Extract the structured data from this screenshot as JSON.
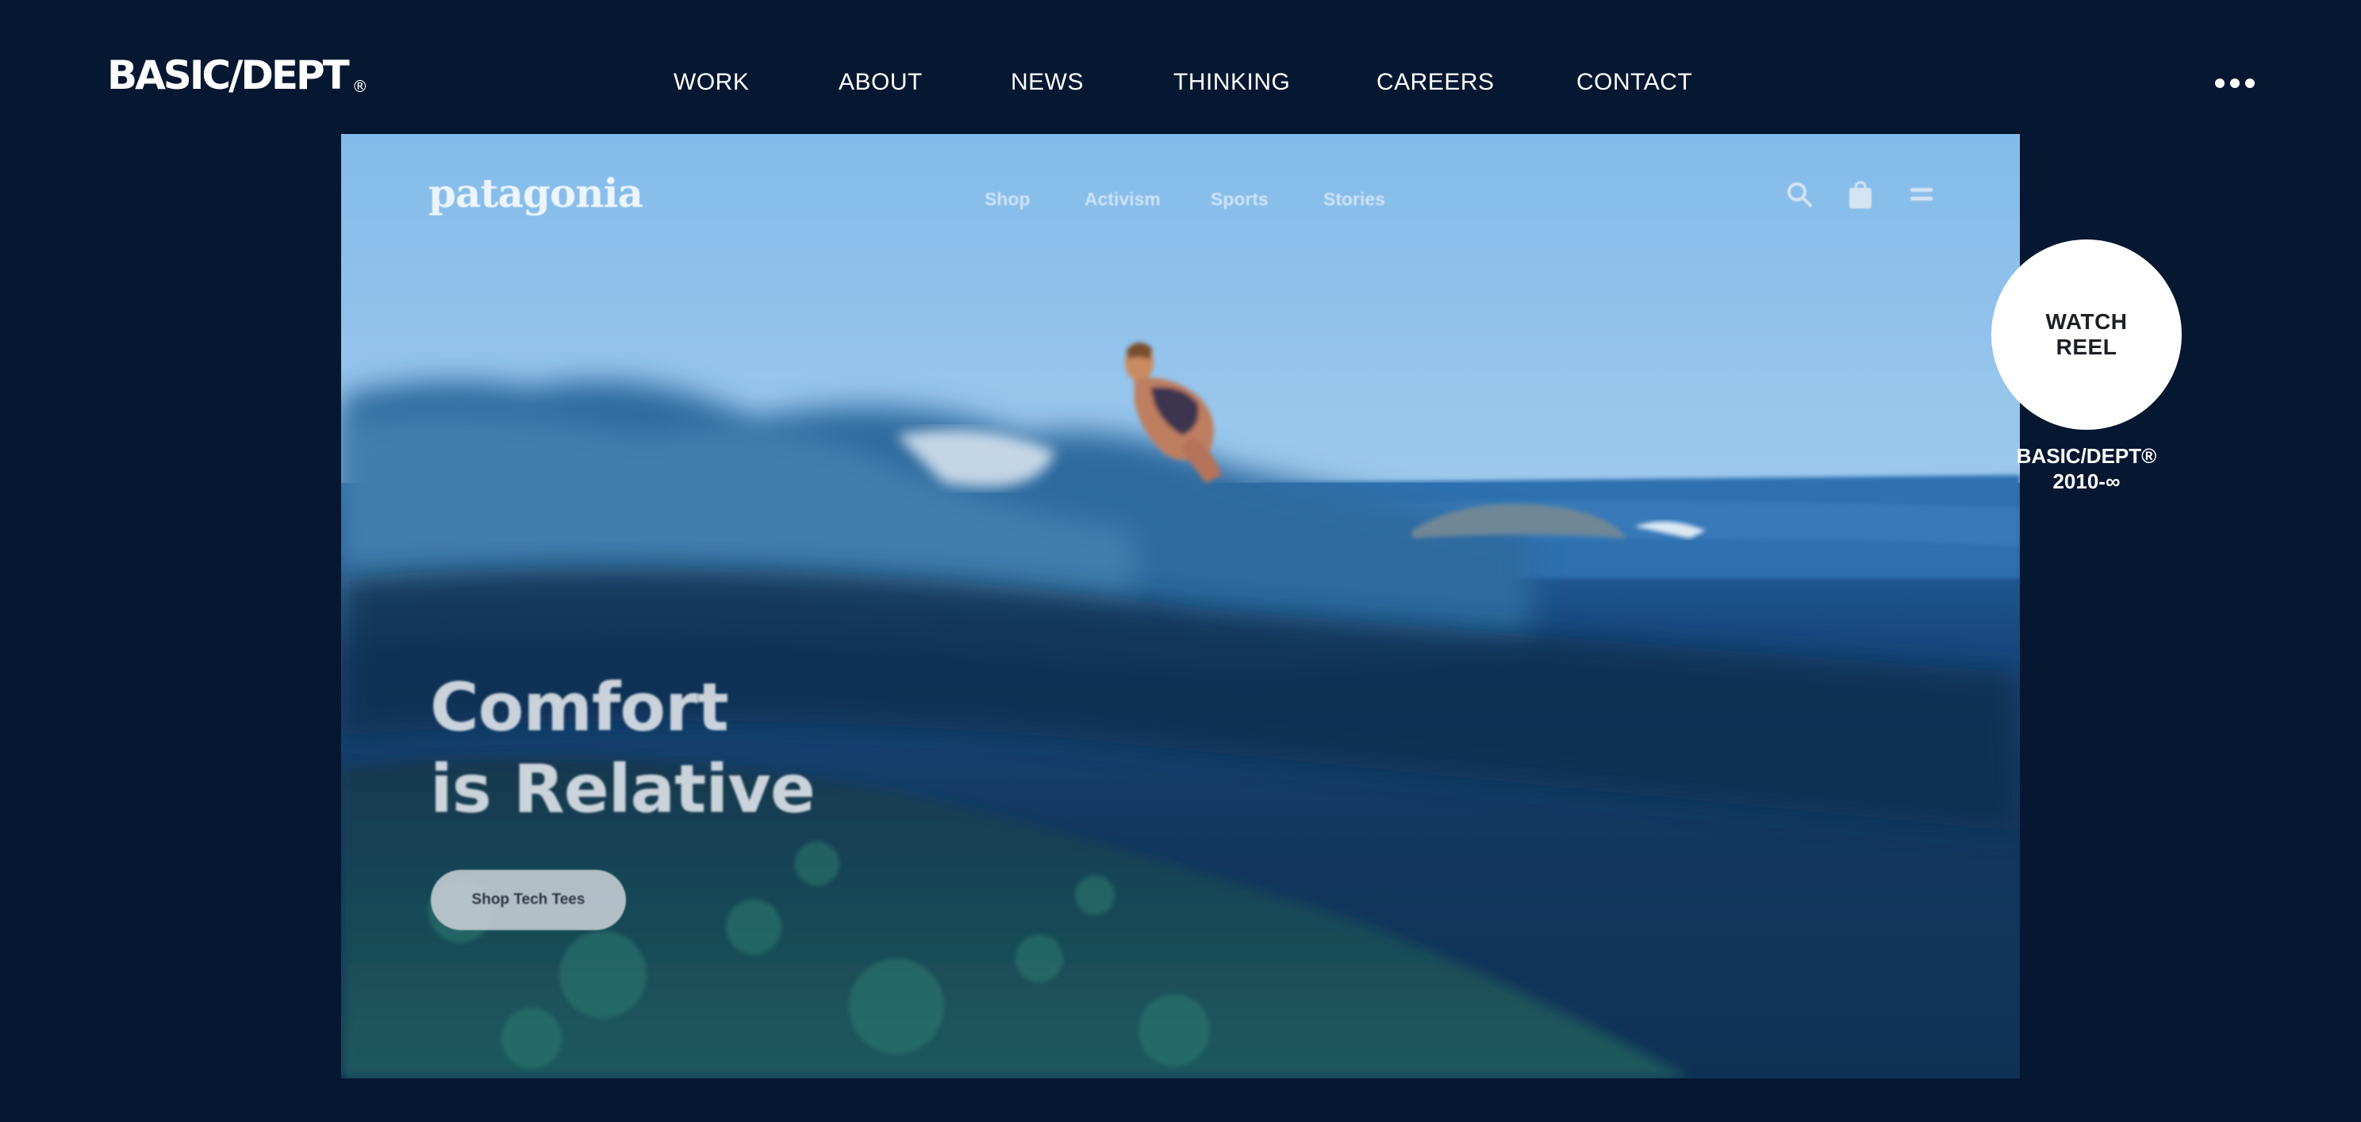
{
  "header": {
    "logo_text": "BASIC/DEPT",
    "logo_mark": "®",
    "nav": [
      "WORK",
      "ABOUT",
      "NEWS",
      "THINKING",
      "CAREERS",
      "CONTACT"
    ],
    "more_icon": "more-dots-icon"
  },
  "hero": {
    "brand_logo": "patagonia",
    "nav": [
      "Shop",
      "Activism",
      "Sports",
      "Stories"
    ],
    "icons": [
      "search-icon",
      "shopping-bag-icon",
      "menu-icon"
    ],
    "headline_line1": "Comfort",
    "headline_line2": "is Relative",
    "cta_label": "Shop Tech Tees"
  },
  "reel": {
    "line1": "WATCH",
    "line2": "REEL",
    "caption_line1": "BASIC/DEPT®",
    "caption_line2": "2010-∞"
  },
  "colors": {
    "page_background": "#061731",
    "text": "#ffffff",
    "reel_button": "#ffffff"
  }
}
